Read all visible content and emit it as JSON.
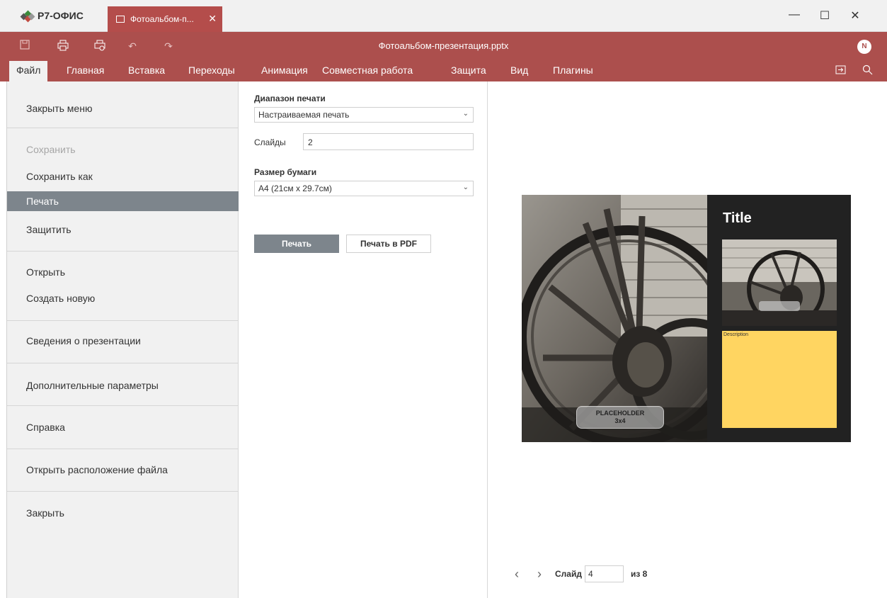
{
  "app": {
    "brand": "Р7-ОФИС",
    "tab_label": "Фотоальбом-п...",
    "document_title": "Фотоальбом-презентация.pptx",
    "user_initial": "N"
  },
  "colors": {
    "accent": "#ac4f4d",
    "selected": "#7d858c",
    "panel": "#f1f1f1",
    "description_box": "#ffd561"
  },
  "toolbar": {
    "icons": [
      "save-icon",
      "print-icon",
      "quick-print-icon",
      "undo-icon",
      "redo-icon"
    ]
  },
  "menu": {
    "tabs": [
      "Файл",
      "Главная",
      "Вставка",
      "Переходы",
      "Анимация",
      "Совместная работа",
      "Защита",
      "Вид",
      "Плагины"
    ]
  },
  "file_menu": {
    "items": [
      {
        "label": "Закрыть меню"
      },
      {
        "label": "Сохранить"
      },
      {
        "label": "Сохранить как"
      },
      {
        "label": "Печать"
      },
      {
        "label": "Защитить"
      },
      {
        "label": "Открыть"
      },
      {
        "label": "Создать новую"
      },
      {
        "label": "Сведения о презентации"
      },
      {
        "label": "Дополнительные параметры"
      },
      {
        "label": "Справка"
      },
      {
        "label": "Открыть расположение файла"
      },
      {
        "label": "Закрыть"
      }
    ]
  },
  "print_settings": {
    "range_label": "Диапазон печати",
    "range_value": "Настраиваемая печать",
    "slides_label": "Слайды",
    "slides_value": "2",
    "paper_label": "Размер бумаги",
    "paper_value": "A4 (21см x 29.7см)",
    "print_button": "Печать",
    "pdf_button": "Печать в PDF"
  },
  "preview": {
    "slide_title": "Title",
    "description": "Description",
    "placeholder_line1": "PLACEHOLDER",
    "placeholder_line2": "3x4",
    "slide_label": "Слайд",
    "current_slide": "4",
    "total_text": "из 8"
  }
}
